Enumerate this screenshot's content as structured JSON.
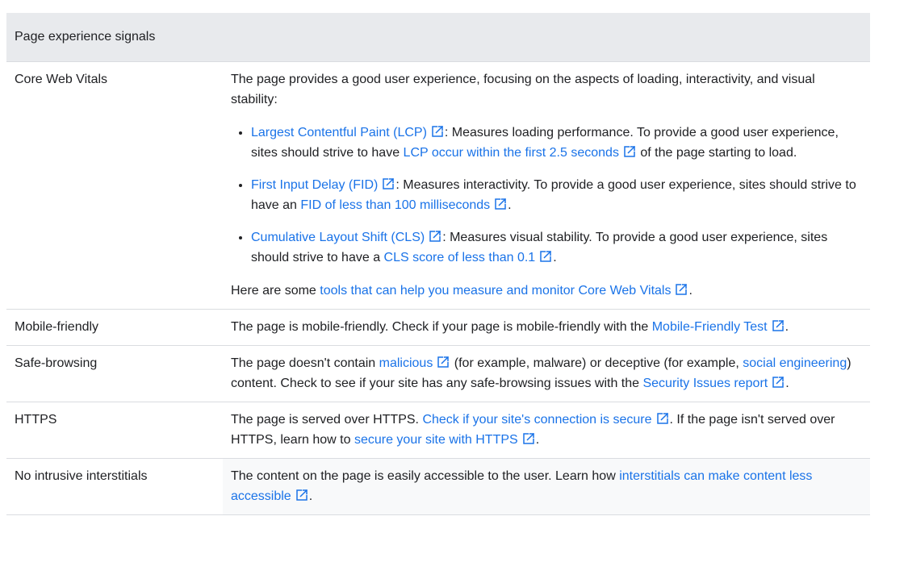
{
  "table": {
    "header": "Page experience signals",
    "rows": {
      "cwv": {
        "label": "Core Web Vitals",
        "intro": "The page provides a good user experience, focusing on the aspects of loading, interactivity, and visual stability:",
        "items": [
          {
            "link": "Largest Contentful Paint (LCP)",
            "text1": ": Measures loading performance. To provide a good user experience, sites should strive to have ",
            "link2": "LCP occur within the first 2.5 seconds",
            "text2": " of the page starting to load."
          },
          {
            "link": "First Input Delay (FID)",
            "text1": ": Measures interactivity. To provide a good user experience, sites should strive to have an ",
            "link2": "FID of less than 100 milliseconds",
            "text2": "."
          },
          {
            "link": "Cumulative Layout Shift (CLS)",
            "text1": ": Measures visual stability. To provide a good user experience, sites should strive to have a ",
            "link2": "CLS score of less than 0.1",
            "text2": "."
          }
        ],
        "outro_prefix": "Here are some ",
        "outro_link": "tools that can help you measure and monitor Core Web Vitals",
        "outro_suffix": "."
      },
      "mobile": {
        "label": "Mobile-friendly",
        "text1": "The page is mobile-friendly. Check if your page is mobile-friendly with the ",
        "link1": "Mobile-Friendly Test",
        "text2": "."
      },
      "safe": {
        "label": "Safe-browsing",
        "text1": "The page doesn't contain ",
        "link1": "malicious",
        "text2": " (for example, malware) or deceptive (for example, ",
        "link2": "social engineering",
        "text3": ") content. Check to see if your site has any safe-browsing issues with the ",
        "link3": "Security Issues report",
        "text4": "."
      },
      "https": {
        "label": "HTTPS",
        "text1": "The page is served over HTTPS. ",
        "link1": "Check if your site's connection is secure",
        "text2": ". If the page isn't served over HTTPS, learn how to ",
        "link2": "secure your site with HTTPS",
        "text3": "."
      },
      "interstitials": {
        "label": "No intrusive interstitials",
        "text1": "The content on the page is easily accessible to the user. Learn how ",
        "link1": "interstitials can make content less accessible",
        "text2": "."
      }
    }
  },
  "icons": {
    "external": "external-link-icon"
  },
  "colors": {
    "link": "#1a73e8",
    "header_bg": "#e8eaed",
    "border": "#dadce0",
    "text": "#202124"
  }
}
